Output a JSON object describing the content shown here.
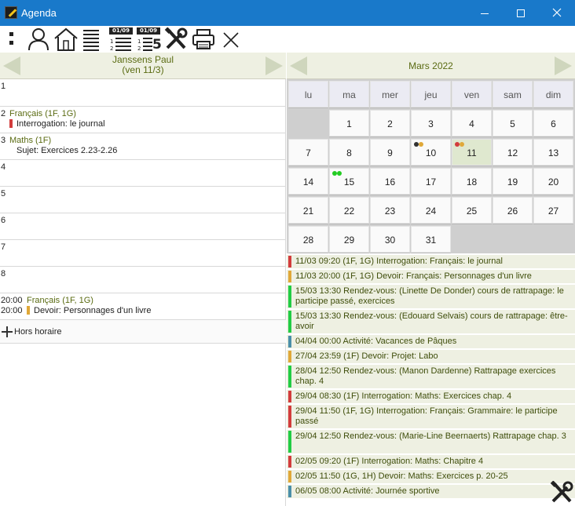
{
  "window": {
    "title": "Agenda",
    "icon": "notepad-pen-icon",
    "controls": [
      "minimize-icon",
      "maximize-icon",
      "close-icon"
    ]
  },
  "toolbar": {
    "icons": [
      "menu-dots-icon",
      "user-icon",
      "home-icon",
      "list-icon",
      "date-list-icon",
      "date-list-5-icon",
      "tools-icon",
      "printer-icon",
      "close-icon"
    ],
    "date_badge_1": "01/09",
    "date_badge_2": "01/09",
    "five": "5"
  },
  "left": {
    "person": "Janssens Paul",
    "date": "(ven 11/3)",
    "slots": [
      {
        "num": "1"
      },
      {
        "num": "2",
        "course": "Français (1F, 1G)",
        "detail": "Interrogation: le journal",
        "color": "#d23c3c"
      },
      {
        "num": "3",
        "course": "Maths (1F)",
        "detail": "Sujet: Exercices 2.23-2.26"
      },
      {
        "num": "4"
      },
      {
        "num": "5"
      },
      {
        "num": "6"
      },
      {
        "num": "7"
      },
      {
        "num": "8"
      }
    ],
    "extra": {
      "time1": "20:00",
      "course": "Français (1F, 1G)",
      "time2": "20:00",
      "detail": "Devoir: Personnages d'un livre",
      "color": "#e0a838"
    },
    "hors_horaire": "Hors horaire"
  },
  "calendar": {
    "month": "Mars 2022",
    "weekdays": [
      "lu",
      "ma",
      "mer",
      "jeu",
      "ven",
      "sam",
      "dim"
    ],
    "weeks": [
      [
        "",
        "1",
        "2",
        "3",
        "4",
        "5",
        "6"
      ],
      [
        "7",
        "8",
        "9",
        "10",
        "11",
        "12",
        "13"
      ],
      [
        "14",
        "15",
        "16",
        "17",
        "18",
        "19",
        "20"
      ],
      [
        "21",
        "22",
        "23",
        "24",
        "25",
        "26",
        "27"
      ],
      [
        "28",
        "29",
        "30",
        "31",
        "",
        "",
        ""
      ]
    ],
    "today": "11",
    "dots": {
      "10": [
        "#333333",
        "#e0a838"
      ],
      "11": [
        "#d23c3c",
        "#e0a838"
      ],
      "15": [
        "#22cc22",
        "#22cc22"
      ]
    }
  },
  "events": [
    {
      "text": "11/03 09:20 (1F, 1G) Interrogation: Français: le journal",
      "color": "#d23c3c"
    },
    {
      "text": "11/03 20:00 (1F, 1G) Devoir: Français: Personnages d'un livre",
      "color": "#e0a838"
    },
    {
      "text": "15/03 13:30 Rendez-vous: (Linette De Donder) cours de rattrapage: le participe passé, exercices",
      "color": "#22cc44"
    },
    {
      "text": "15/03 13:30 Rendez-vous: (Edouard Selvais) cours de rattrapage: être-avoir",
      "color": "#22cc44"
    },
    {
      "text": "04/04 00:00 Activité: Vacances de Pâques",
      "color": "#4a8fa8"
    },
    {
      "text": "27/04 23:59 (1F) Devoir: Projet: Labo",
      "color": "#e0a838"
    },
    {
      "text": "28/04 12:50 Rendez-vous: (Manon Dardenne) Rattrapage exercices chap. 4",
      "color": "#22cc44"
    },
    {
      "text": "29/04 08:30 (1F) Interrogation: Maths: Exercices chap. 4",
      "color": "#d23c3c"
    },
    {
      "text": "29/04 11:50 (1F, 1G) Interrogation: Français: Grammaire: le participe passé",
      "color": "#d23c3c"
    },
    {
      "text": "29/04 12:50 Rendez-vous: (Marie-Line Beernaerts) Rattrapage chap. 3",
      "color": "#22cc44"
    },
    {
      "text": "02/05 09:20 (1F) Interrogation: Maths: Chapitre 4",
      "color": "#d23c3c"
    },
    {
      "text": "02/05 11:50 (1G, 1H) Devoir: Maths: Exercices p. 20-25",
      "color": "#e0a838"
    },
    {
      "text": "06/05 08:00 Activité: Journée sportive",
      "color": "#4a8fa8"
    }
  ]
}
